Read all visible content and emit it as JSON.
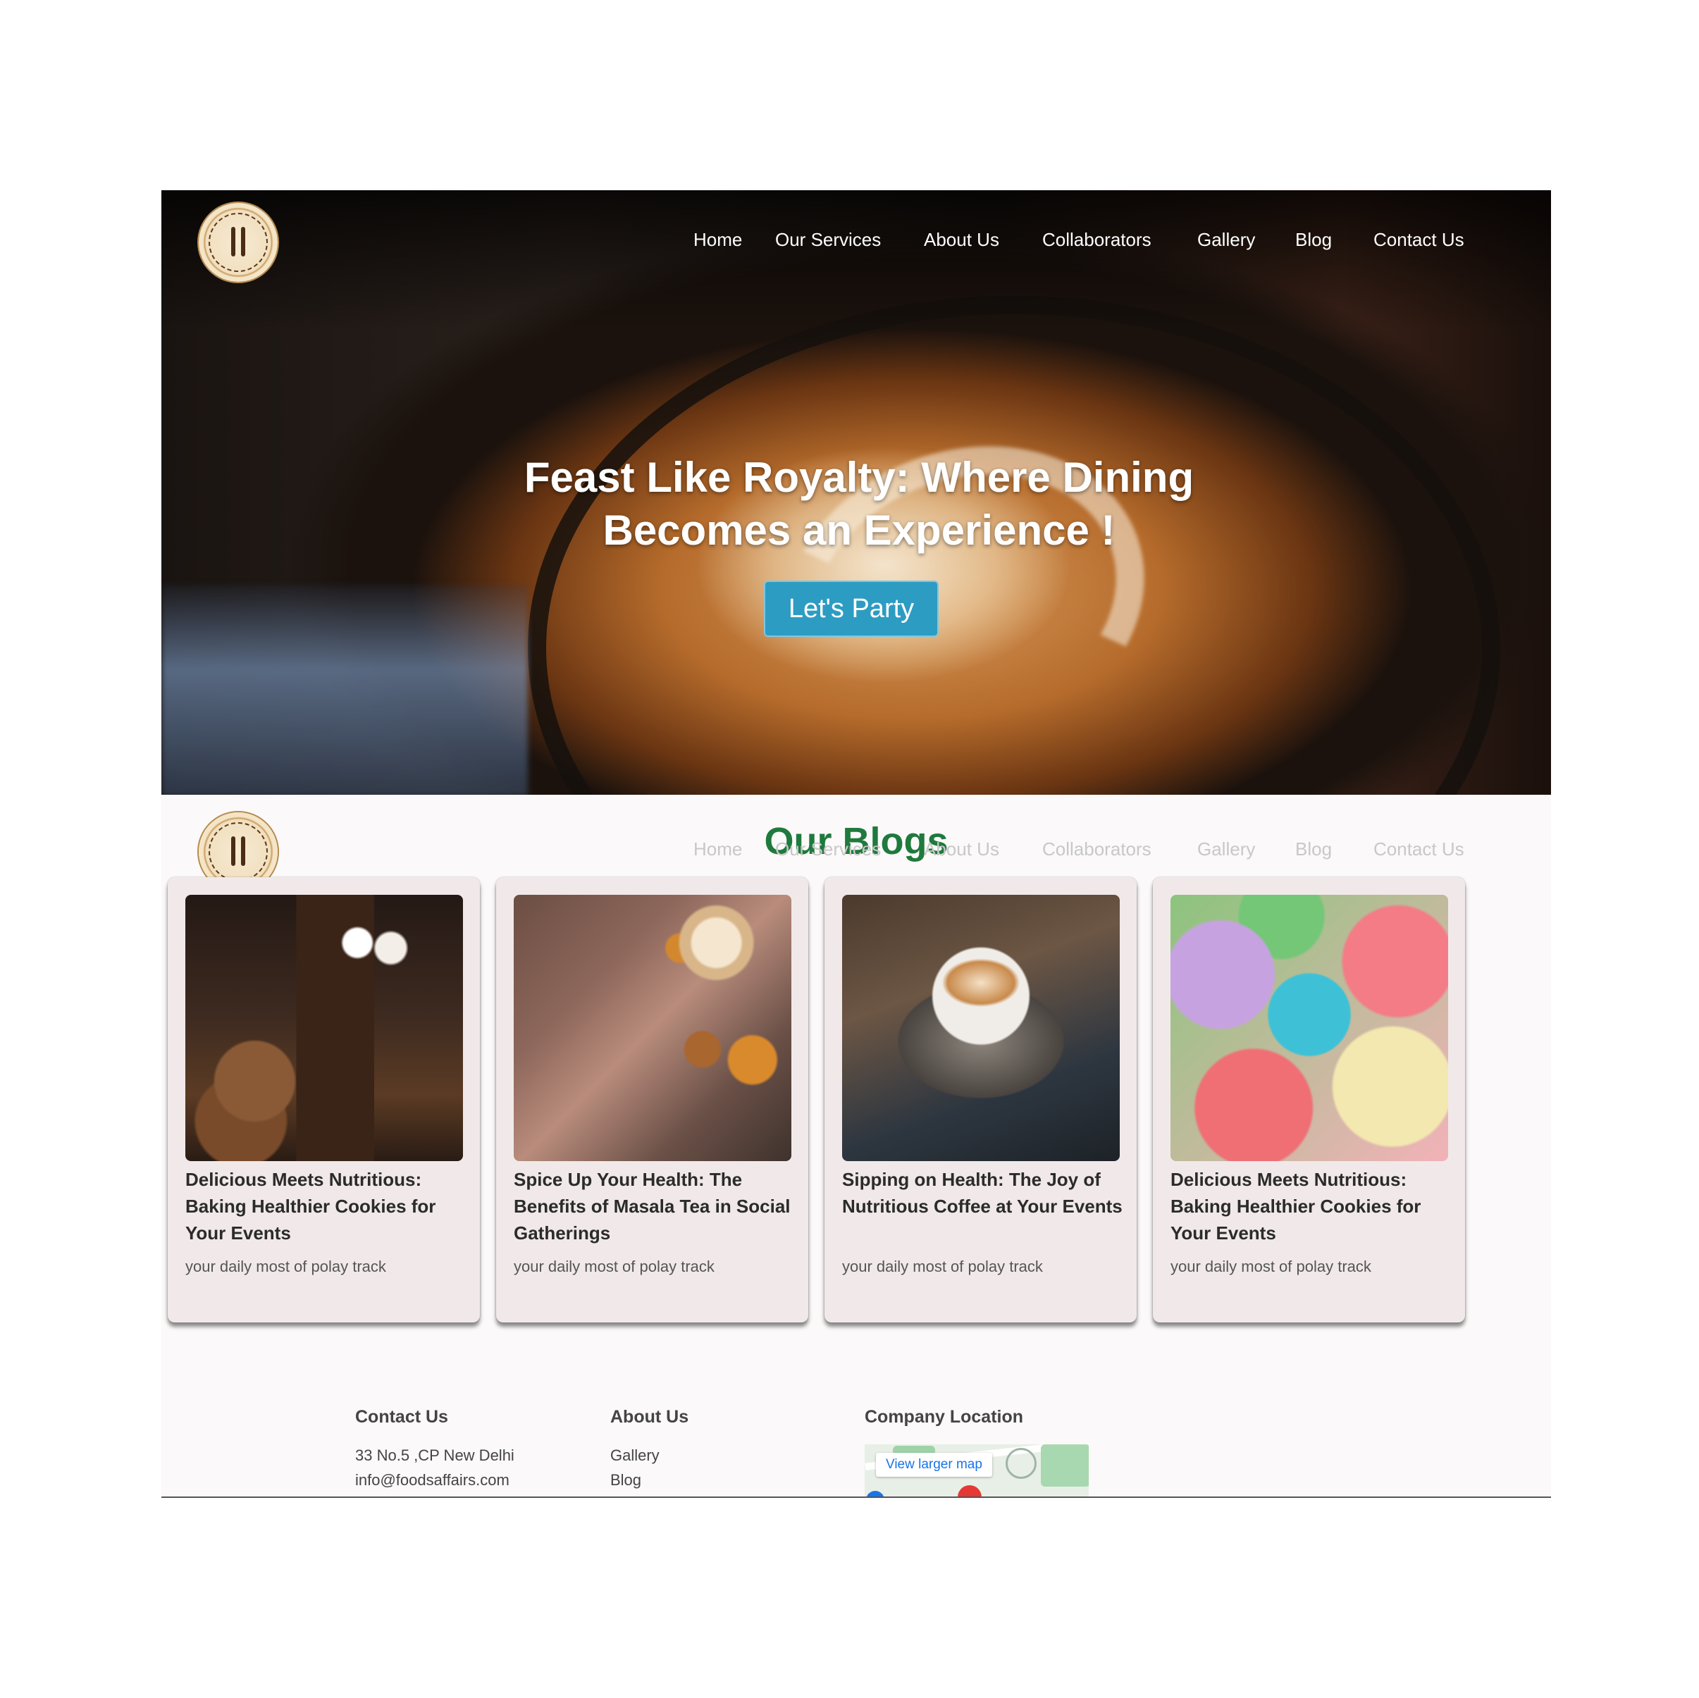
{
  "header": {
    "logo_alt": "FOODS AFFAIR - EVERY BITE TELLS A STORY",
    "nav": [
      "Home",
      "Our Services",
      "About Us",
      "Collaborators",
      "Gallery",
      "Blog",
      "Contact Us"
    ]
  },
  "hero": {
    "title_line1": "Feast Like Royalty: Where Dining",
    "title_line2": "Becomes an Experience !",
    "cta_label": "Let's Party"
  },
  "blogs": {
    "title": "Our Blogs",
    "cards": [
      {
        "title": "Delicious Meets Nutritious: Baking Healthier Cookies for Your Events",
        "subtitle": "your daily most of polay track"
      },
      {
        "title": "Spice Up Your Health: The Benefits of Masala Tea in Social Gatherings",
        "subtitle": "your daily most of polay track"
      },
      {
        "title": "Sipping on Health: The Joy of Nutritious Coffee at Your Events",
        "subtitle": "your daily most of polay track"
      },
      {
        "title": "Delicious Meets Nutritious: Baking Healthier Cookies for Your Events",
        "subtitle": "your daily most of polay track"
      }
    ]
  },
  "footer": {
    "contact": {
      "heading": "Contact Us",
      "address": "33 No.5 ,CP New Delhi",
      "email": "info@foodsaffairs.com"
    },
    "about": {
      "heading": "About Us",
      "links": [
        "Gallery",
        "Blog"
      ]
    },
    "location": {
      "heading": "Company Location",
      "map_button": "View larger map"
    }
  },
  "colors": {
    "accent": "#2d9cc3",
    "blog_title": "#1f7a3d",
    "card_bg": "#f1e9e9"
  }
}
